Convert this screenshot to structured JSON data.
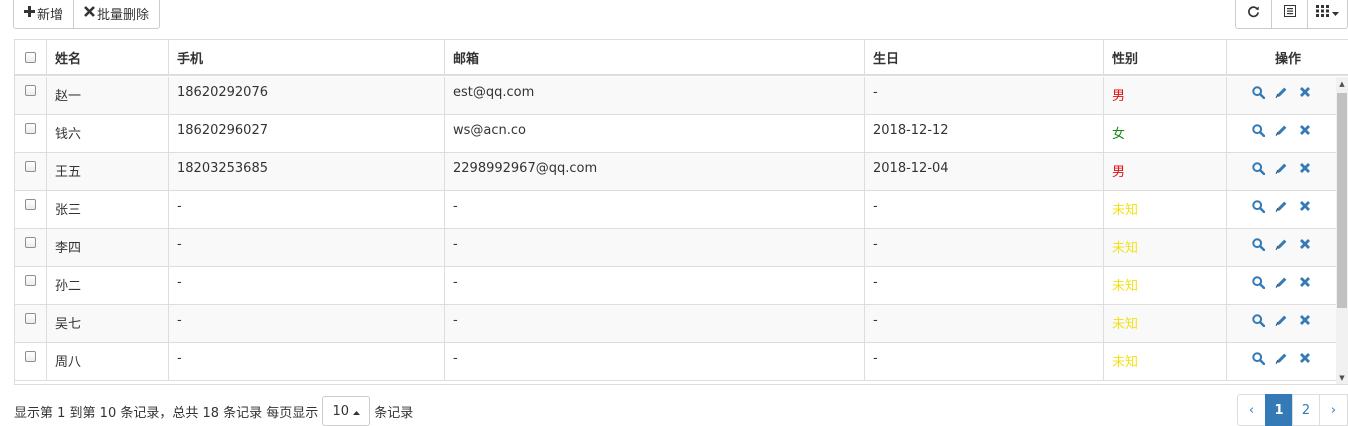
{
  "toolbar": {
    "add_label": "新增",
    "add_icon": "plus-icon",
    "batch_delete_label": "批量删除",
    "batch_delete_icon": "remove-icon",
    "refresh_icon": "refresh-icon",
    "toggle_view_icon": "list-icon",
    "columns_icon": "grid-icon"
  },
  "table": {
    "headers": [
      "姓名",
      "手机",
      "邮箱",
      "生日",
      "性别",
      "操作"
    ],
    "rows": [
      {
        "name": "赵一",
        "phone": "18620292076",
        "email": "est@qq.com",
        "birthday": "-",
        "gender": "男",
        "gender_type": "male"
      },
      {
        "name": "钱六",
        "phone": "18620296027",
        "email": "ws@acn.co",
        "birthday": "2018-12-12",
        "gender": "女",
        "gender_type": "female"
      },
      {
        "name": "王五",
        "phone": "18203253685",
        "email": "2298992967@qq.com",
        "birthday": "2018-12-04",
        "gender": "男",
        "gender_type": "male"
      },
      {
        "name": "张三",
        "phone": "-",
        "email": "-",
        "birthday": "-",
        "gender": "未知",
        "gender_type": "unknown"
      },
      {
        "name": "李四",
        "phone": "-",
        "email": "-",
        "birthday": "-",
        "gender": "未知",
        "gender_type": "unknown"
      },
      {
        "name": "孙二",
        "phone": "-",
        "email": "-",
        "birthday": "-",
        "gender": "未知",
        "gender_type": "unknown"
      },
      {
        "name": "吴七",
        "phone": "-",
        "email": "-",
        "birthday": "-",
        "gender": "未知",
        "gender_type": "unknown"
      },
      {
        "name": "周八",
        "phone": "-",
        "email": "-",
        "birthday": "-",
        "gender": "未知",
        "gender_type": "unknown"
      }
    ],
    "row_actions": [
      "search-icon",
      "pencil-icon",
      "remove-icon"
    ]
  },
  "colors": {
    "male": "#e01010",
    "female": "#1a8a1a",
    "unknown": "#f2e21a",
    "action": "#337ab7"
  },
  "footer": {
    "info_prefix": "显示第 1 到第 10 条记录，总共 18 条记录 每页显示",
    "page_size": "10",
    "info_suffix": "条记录"
  },
  "pagination": {
    "prev": "‹",
    "pages": [
      "1",
      "2"
    ],
    "active_page": "1",
    "next": "›"
  }
}
